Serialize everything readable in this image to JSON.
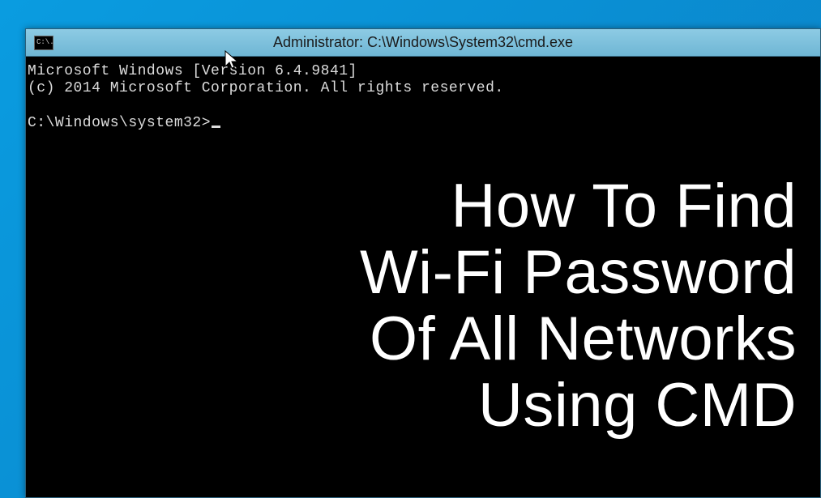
{
  "window": {
    "title": "Administrator: C:\\Windows\\System32\\cmd.exe",
    "icon_label": "C:\\."
  },
  "terminal": {
    "line1": "Microsoft Windows [Version 6.4.9841]",
    "line2": "(c) 2014 Microsoft Corporation. All rights reserved.",
    "blank": "",
    "prompt": "C:\\Windows\\system32>"
  },
  "overlay": {
    "heading": "How To Find\nWi-Fi Password\nOf All Networks\nUsing CMD"
  }
}
